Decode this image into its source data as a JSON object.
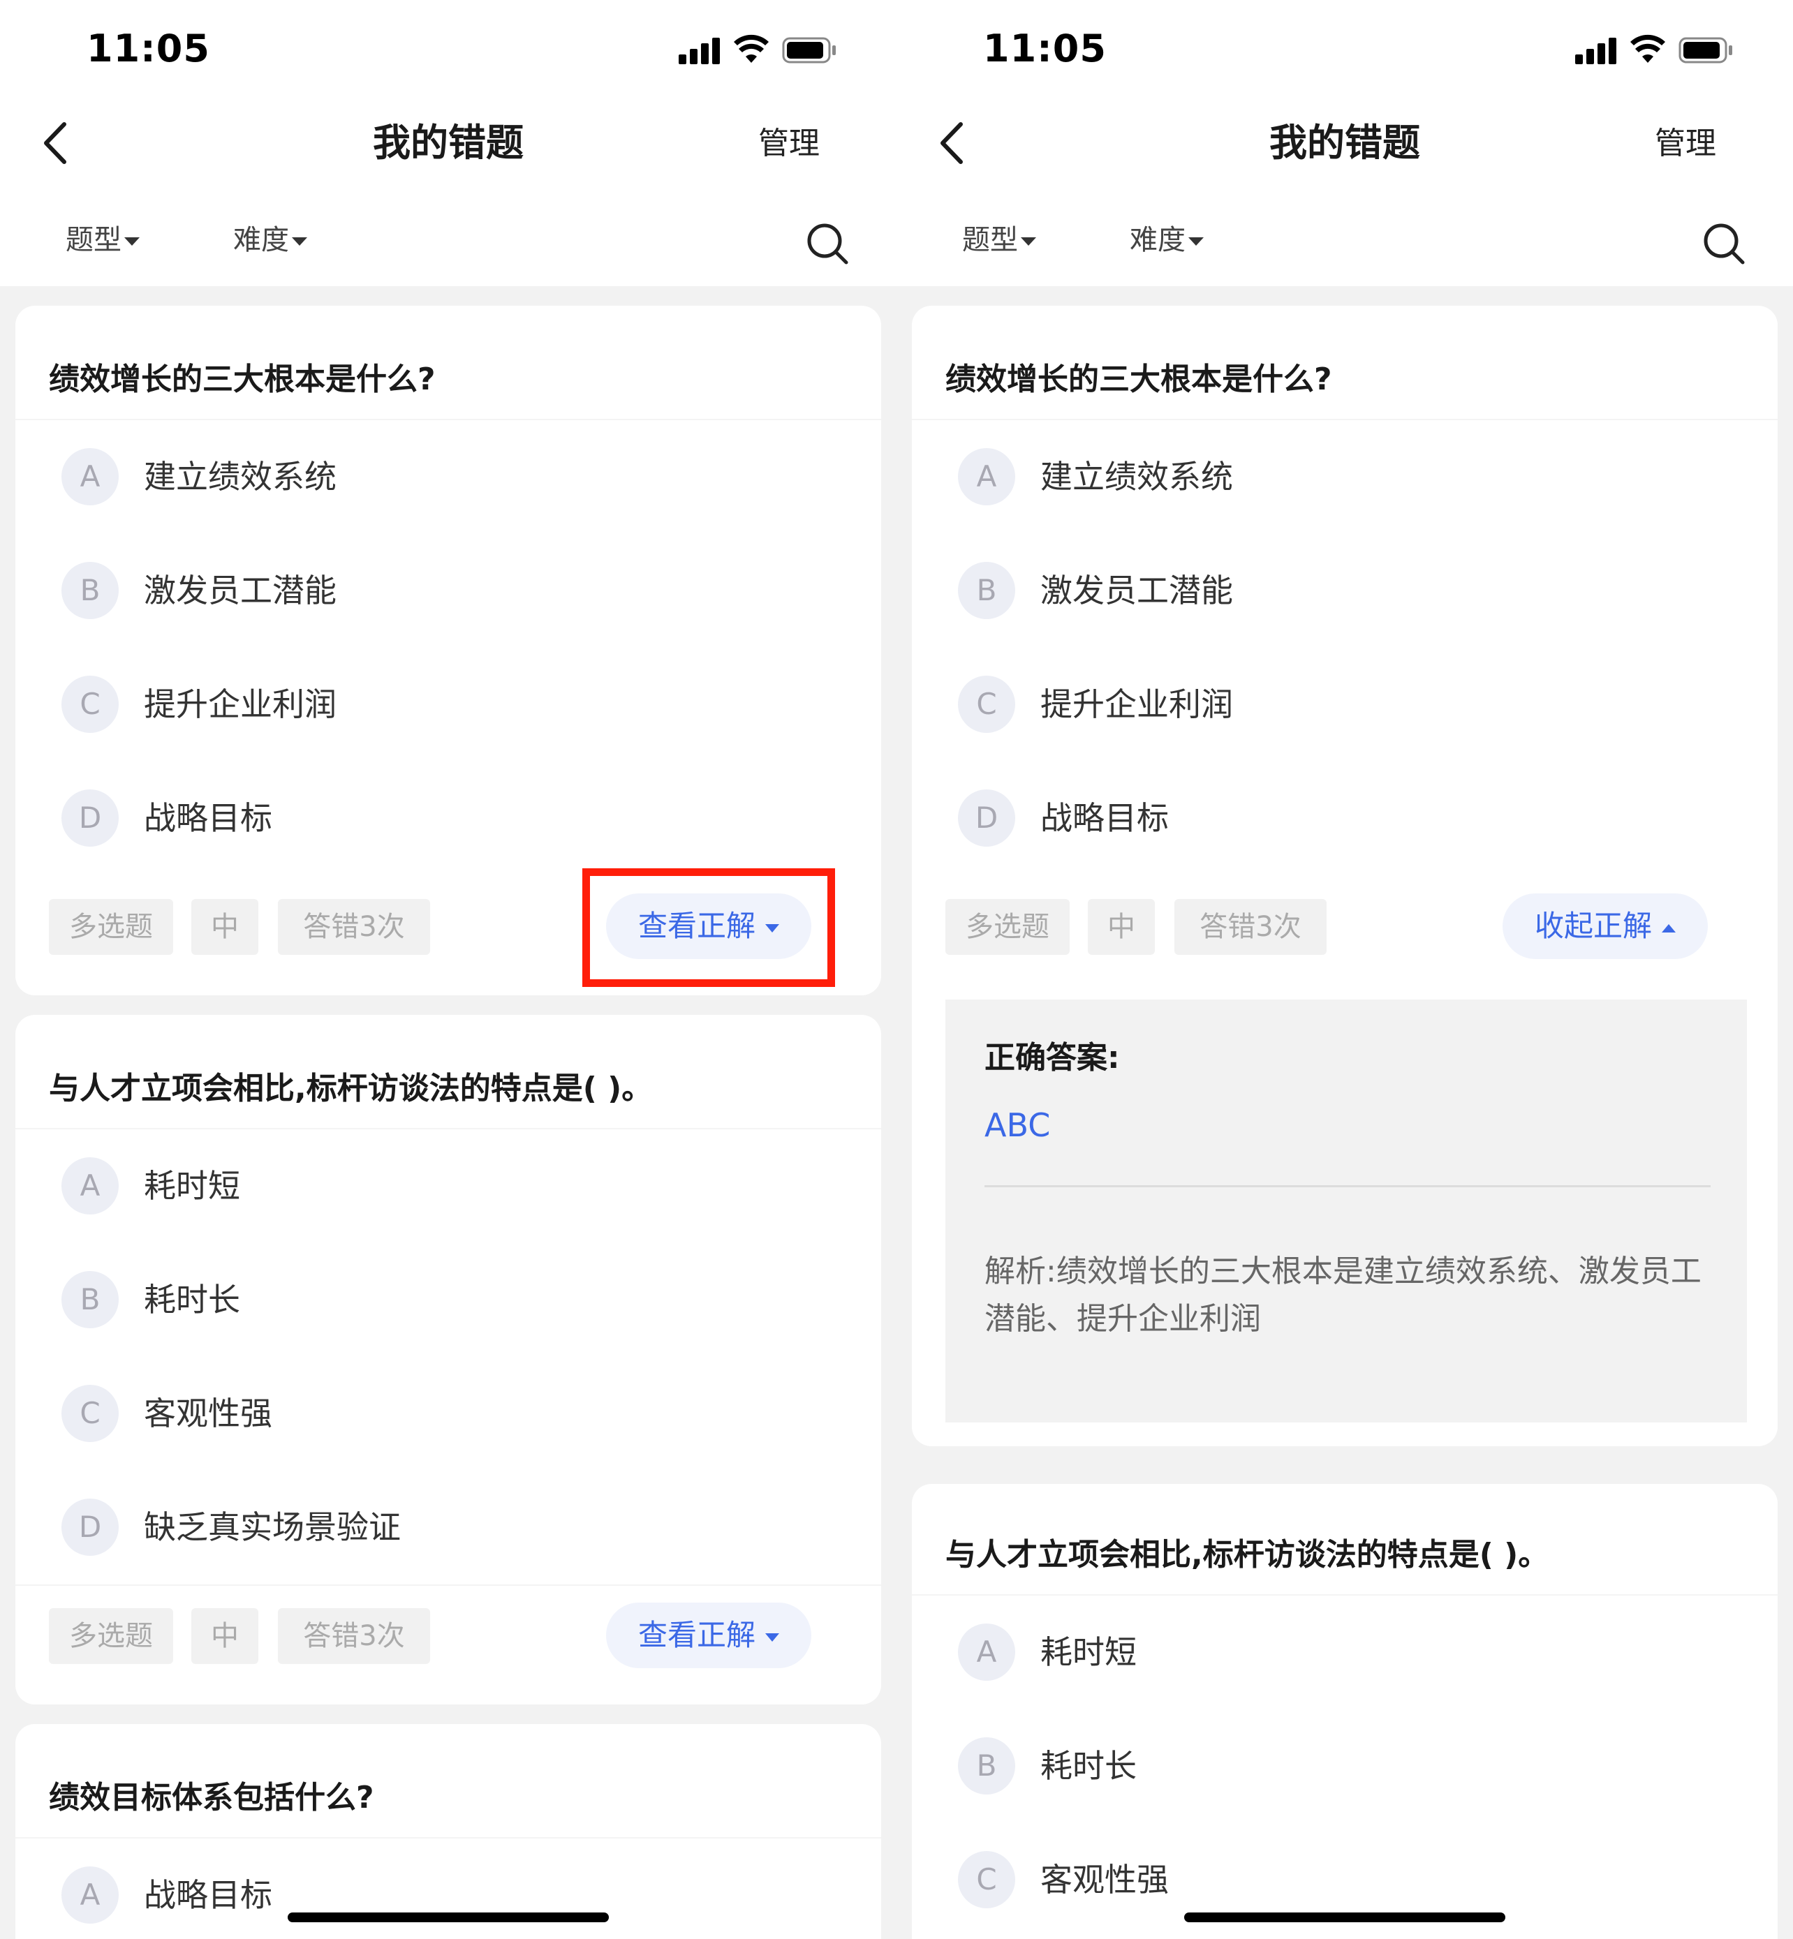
{
  "status_bar": {
    "time": "11:05"
  },
  "nav": {
    "title": "我的错题",
    "manage": "管理"
  },
  "filters": {
    "type": "题型",
    "difficulty": "难度"
  },
  "questions": [
    {
      "text": "绩效增长的三大根本是什么?",
      "options": [
        {
          "letter": "A",
          "text": "建立绩效系统"
        },
        {
          "letter": "B",
          "text": "激发员工潜能"
        },
        {
          "letter": "C",
          "text": "提升企业利润"
        },
        {
          "letter": "D",
          "text": "战略目标"
        }
      ],
      "tags": {
        "type": "多选题",
        "difficulty": "中",
        "wrong_count": "答错3次"
      },
      "view_answer": "查看正解",
      "collapse_answer": "收起正解",
      "answer_label": "正确答案:",
      "answer": "ABC",
      "explanation": "解析:绩效增长的三大根本是建立绩效系统、激发员工潜能、提升企业利润"
    },
    {
      "text": "与人才立项会相比,标杆访谈法的特点是( )。",
      "options": [
        {
          "letter": "A",
          "text": "耗时短"
        },
        {
          "letter": "B",
          "text": "耗时长"
        },
        {
          "letter": "C",
          "text": "客观性强"
        },
        {
          "letter": "D",
          "text": "缺乏真实场景验证"
        }
      ],
      "tags": {
        "type": "多选题",
        "difficulty": "中",
        "wrong_count": "答错3次"
      },
      "view_answer": "查看正解"
    },
    {
      "text": "绩效目标体系包括什么?",
      "options": [
        {
          "letter": "A",
          "text": "战略目标"
        }
      ]
    }
  ]
}
